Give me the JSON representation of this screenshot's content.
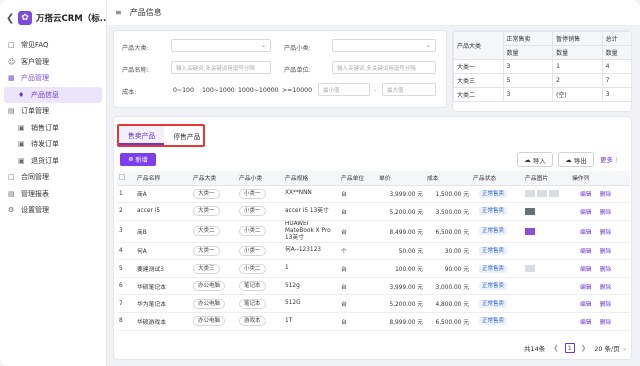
{
  "brand": {
    "title": "万搭云CRM（标..."
  },
  "sidebar": {
    "items": [
      {
        "label": "常见FAQ",
        "icon": "faq-icon"
      },
      {
        "label": "客户管理",
        "icon": "customer-icon"
      },
      {
        "label": "产品管理",
        "icon": "folder-icon"
      },
      {
        "label": "产品信息",
        "icon": "diamond-icon"
      },
      {
        "label": "订单管理",
        "icon": "order-icon"
      },
      {
        "label": "销售订单",
        "icon": "doc-icon"
      },
      {
        "label": "待发订单",
        "icon": "doc-icon"
      },
      {
        "label": "退货订单",
        "icon": "doc-icon"
      },
      {
        "label": "合同管理",
        "icon": "contract-icon"
      },
      {
        "label": "管理报表",
        "icon": "report-icon"
      },
      {
        "label": "设置管理",
        "icon": "settings-icon"
      }
    ]
  },
  "header": {
    "title": "产品信息"
  },
  "filter": {
    "category_label": "产品大类:",
    "subcategory_label": "产品小类:",
    "name_label": "产品名称:",
    "unit_label": "产品单位:",
    "name_placeholder": "输入关键词,多关键词用逗号分隔",
    "unit_placeholder": "输入关键词,多关键词用逗号分隔",
    "cost_label": "成本:",
    "ranges": [
      "0~100",
      "100~1000",
      "1000~10000",
      ">=10000"
    ],
    "min_placeholder": "最小值",
    "max_placeholder": "最大值",
    "separator": "-"
  },
  "stats": {
    "header_top": [
      "产品大类",
      "正常售卖",
      "暂停销售",
      "总计"
    ],
    "header_sub": [
      "数量",
      "数量",
      "数量"
    ],
    "rows": [
      [
        "大类一",
        "3",
        "1",
        "4"
      ],
      [
        "大类三",
        "5",
        "2",
        "7"
      ],
      [
        "大类二",
        "3",
        "(空)",
        "3"
      ]
    ]
  },
  "tabs": {
    "selling": "售卖产品",
    "stopped": "停售产品"
  },
  "toolbar": {
    "new": "新增",
    "import": "导入",
    "export": "导出",
    "more": "更多"
  },
  "table": {
    "columns": [
      "",
      "产品名称",
      "产品大类",
      "产品小类",
      "产品规格",
      "产品单位",
      "单价",
      "成本",
      "产品状态",
      "产品图片",
      "操作列"
    ],
    "rows": [
      {
        "no": "1",
        "name": "商A",
        "cat": "大类一",
        "sub": "小类一",
        "spec": "XX**NNN",
        "unit": "台",
        "price": "3,999.00 元",
        "cost": "1,500.00 元",
        "status": "正常售卖",
        "img": "multi",
        "edit": "编辑",
        "del": "删除"
      },
      {
        "no": "2",
        "name": "accer i5",
        "cat": "大类一",
        "sub": "小类一",
        "spec": "accer i5 13英寸",
        "unit": "台",
        "price": "5,200.00 元",
        "cost": "3,500.00 元",
        "status": "正常售卖",
        "img": "dark",
        "edit": "编辑",
        "del": "删除"
      },
      {
        "no": "3",
        "name": "商B",
        "cat": "大类二",
        "sub": "小类二",
        "spec": "HUAWEI MateBook X Pro 13英寸",
        "unit": "台",
        "price": "8,499.00 元",
        "cost": "6,500.00 元",
        "status": "正常售卖",
        "img": "purple",
        "edit": "编辑",
        "del": "删除"
      },
      {
        "no": "4",
        "name": "何A",
        "cat": "大类一",
        "sub": "小类一",
        "spec": "何A--123123",
        "unit": "个",
        "price": "50.00 元",
        "cost": "30.00 元",
        "status": "正常售卖",
        "img": "",
        "edit": "编辑",
        "del": "删除"
      },
      {
        "no": "5",
        "name": "要建测试3",
        "cat": "大类三",
        "sub": "小类二",
        "spec": "1",
        "unit": "台",
        "price": "100.00 元",
        "cost": "90.00 元",
        "status": "正常售卖",
        "img": "light",
        "edit": "编辑",
        "del": "删除"
      },
      {
        "no": "6",
        "name": "华硕笔记本",
        "cat": "办公电脑",
        "sub": "笔记本",
        "spec": "512g",
        "unit": "台",
        "price": "3,999.00 元",
        "cost": "3,000.00 元",
        "status": "正常售卖",
        "img": "",
        "edit": "编辑",
        "del": "删除"
      },
      {
        "no": "7",
        "name": "华为笔记本",
        "cat": "办公电脑",
        "sub": "笔记本",
        "spec": "512G",
        "unit": "台",
        "price": "5,200.00 元",
        "cost": "4,800.00 元",
        "status": "正常售卖",
        "img": "",
        "edit": "编辑",
        "del": "删除"
      },
      {
        "no": "8",
        "name": "华硕游戏本",
        "cat": "办公电脑",
        "sub": "游戏本",
        "spec": "1T",
        "unit": "台",
        "price": "8,999.00 元",
        "cost": "6,500.00 元",
        "status": "正常售卖",
        "img": "",
        "edit": "编辑",
        "del": "删除"
      }
    ]
  },
  "pager": {
    "total": "共14条",
    "page": "1",
    "size": "20 条/页"
  },
  "colors": {
    "accent": "#7b3ff0",
    "highlight_border": "#e53935",
    "status_tag": "#eaf2ff"
  }
}
